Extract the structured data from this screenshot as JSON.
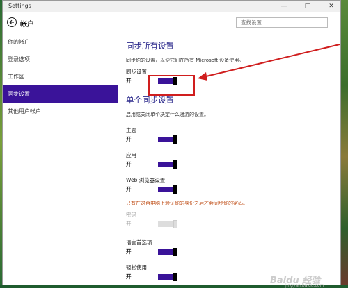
{
  "window": {
    "title": "Settings"
  },
  "header": {
    "title": "帐户",
    "search_placeholder": "查找设置"
  },
  "sidebar": {
    "items": [
      {
        "label": "你的帐户",
        "active": false
      },
      {
        "label": "登录选项",
        "active": false
      },
      {
        "label": "工作区",
        "active": false
      },
      {
        "label": "同步设置",
        "active": true
      },
      {
        "label": "其他用户帐户",
        "active": false
      }
    ]
  },
  "sync_all": {
    "title": "同步所有设置",
    "desc": "同步你的设置，以便它们在所有 Microsoft 设备使用。",
    "setting_label": "同步设置",
    "state": "开"
  },
  "individual": {
    "title": "单个同步设置",
    "desc": "启用或关闭单个决定什么漫游的设置。",
    "items": [
      {
        "label": "主题",
        "state": "开"
      },
      {
        "label": "应用",
        "state": "开"
      },
      {
        "label": "Web 浏览器设置",
        "state": "开"
      }
    ],
    "warning": "只有在这台电脑上验证你的身份之后才会同步你的密码。",
    "password": {
      "label": "密码",
      "state": "开"
    },
    "items_after": [
      {
        "label": "语言首选项",
        "state": "开"
      },
      {
        "label": "轻松使用",
        "state": "开"
      }
    ]
  },
  "colors": {
    "accent": "#3a1399",
    "annotation": "#d01e1e",
    "title": "#2c2a8c"
  },
  "watermark": {
    "text": "Baidu 经验",
    "url": "jingyan.baidu.com"
  }
}
